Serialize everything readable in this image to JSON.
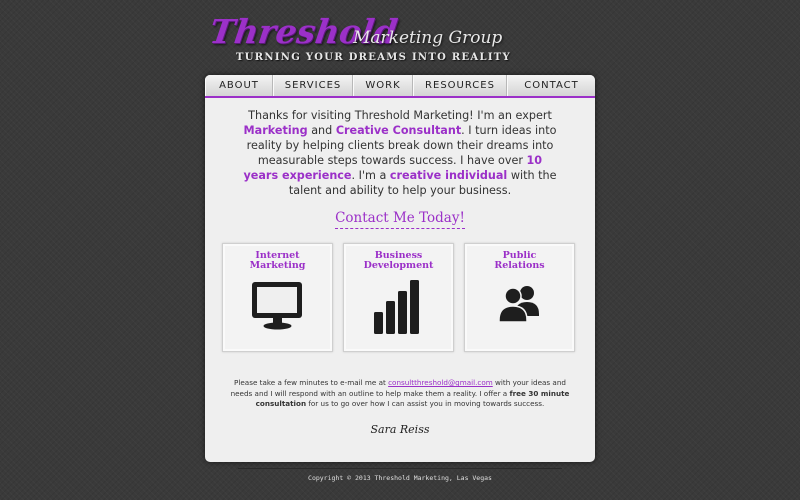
{
  "header": {
    "logo_main": "Threshold",
    "logo_sub": "Marketing Group",
    "tagline": "TURNING YOUR DREAMS INTO REALITY"
  },
  "nav": {
    "items": [
      "ABOUT",
      "SERVICES",
      "WORK",
      "RESOURCES",
      "CONTACT"
    ]
  },
  "intro": {
    "p1": "Thanks for visiting Threshold Marketing! I'm an expert ",
    "h1": "Marketing",
    "p2": " and ",
    "h2": "Creative Consultant",
    "p3": ". I turn ideas into reality by helping clients break down their dreams into measurable steps towards success. I have over ",
    "h3": "10 years experience",
    "p4": ". I'm a ",
    "h4": "creative individual",
    "p5": " with the talent and ability to help your business."
  },
  "cta": {
    "label": "Contact Me Today!"
  },
  "services": [
    {
      "title": "Internet Marketing",
      "icon": "monitor-icon"
    },
    {
      "title": "Business Development",
      "icon": "bar-chart-icon"
    },
    {
      "title": "Public Relations",
      "icon": "people-icon"
    }
  ],
  "contact": {
    "t1": "Please take a few minutes to e-mail me at ",
    "email": "consultthreshold@gmail.com",
    "t2": " with your ideas and needs and I will respond with an outline to help make them a reality. I offer a ",
    "bold": "free 30 minute consultation",
    "t3": " for us to go over how I can assist you in moving towards success."
  },
  "signature": "Sara Reiss",
  "footer": "Copyright © 2013 Threshold Marketing, Las Vegas",
  "colors": {
    "accent": "#9b30c8",
    "background": "#3a3a3a",
    "panel": "#efefef"
  }
}
